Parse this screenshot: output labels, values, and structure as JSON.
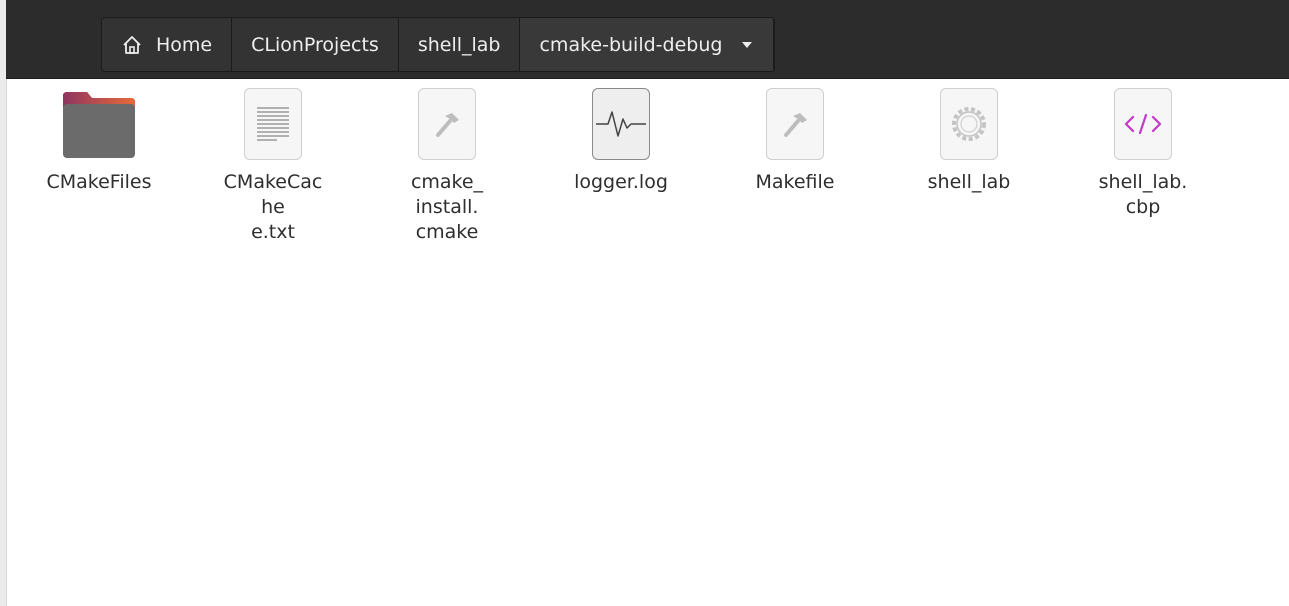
{
  "pathbar": {
    "crumbs": [
      {
        "label": "Home",
        "icon": "home-icon"
      },
      {
        "label": "CLionProjects"
      },
      {
        "label": "shell_lab"
      },
      {
        "label": "cmake-build-debug",
        "icon": "chevron-down-icon"
      }
    ]
  },
  "files": [
    {
      "name": "CMakeFiles",
      "icon": "folder-icon"
    },
    {
      "name": "CMakeCache\ne.txt",
      "icon": "text-file-icon"
    },
    {
      "name": "cmake_\ninstall.\ncmake",
      "icon": "hammer-file-icon"
    },
    {
      "name": "logger.log",
      "icon": "log-file-icon"
    },
    {
      "name": "Makefile",
      "icon": "hammer-file-icon"
    },
    {
      "name": "shell_lab",
      "icon": "executable-gear-icon"
    },
    {
      "name": "shell_lab.\ncbp",
      "icon": "xml-file-icon"
    }
  ],
  "colors": {
    "headerbar": "#2c2c2c",
    "folder_tab": "#a43b5c",
    "folder_body": "#6e6e6e",
    "xml_accent": "#c23ac9"
  }
}
